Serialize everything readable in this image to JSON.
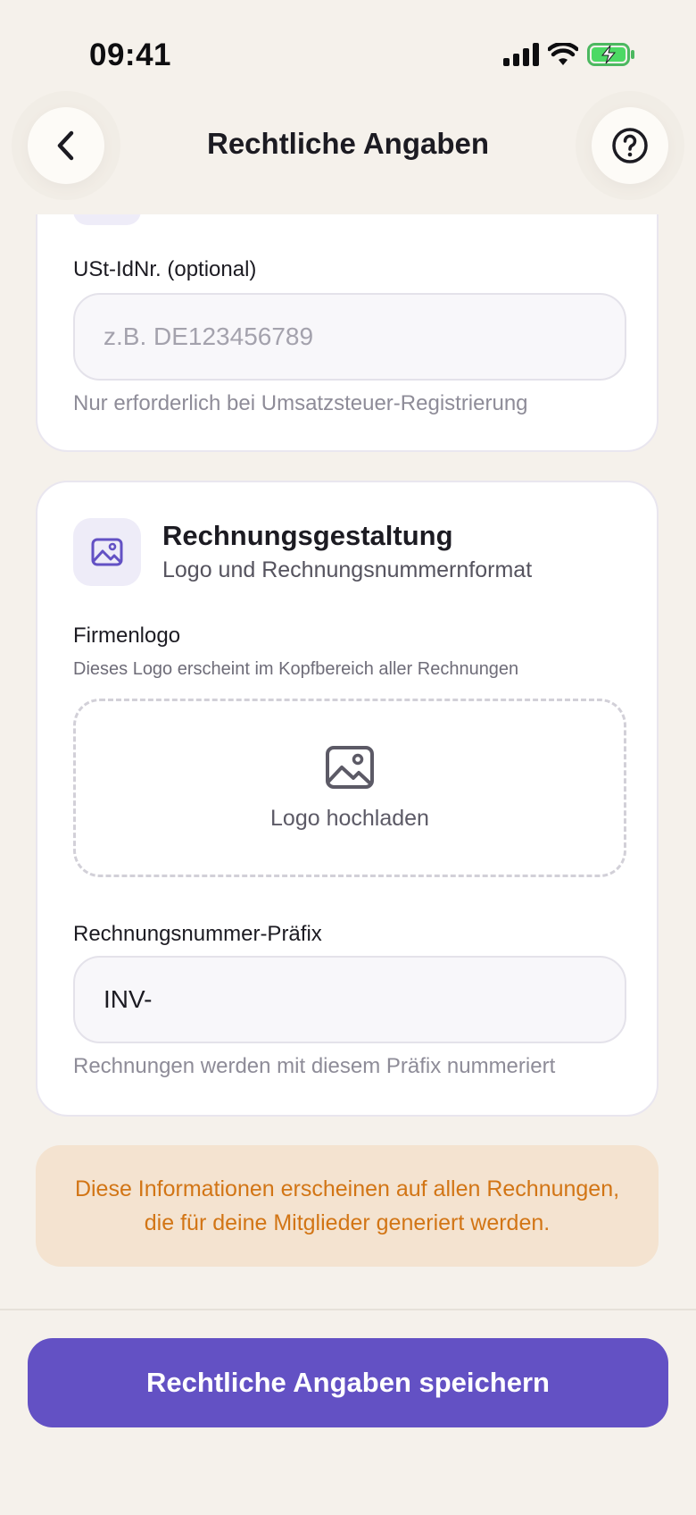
{
  "status_bar": {
    "time": "09:41"
  },
  "header": {
    "title": "Rechtliche Angaben",
    "back_icon": "chevron-left-icon",
    "help_icon": "question-circle-icon"
  },
  "tax_section": {
    "vat_label": "USt-IdNr. (optional)",
    "vat_placeholder": "z.B. DE123456789",
    "vat_value": "",
    "vat_hint": "Nur erforderlich bei Umsatzsteuer-Registrierung"
  },
  "invoice_design": {
    "icon": "image-icon",
    "title": "Rechnungsgestaltung",
    "subtitle": "Logo und Rechnungsnummernformat",
    "logo_label": "Firmenlogo",
    "logo_hint": "Dieses Logo erscheint im Kopfbereich aller Rechnungen",
    "upload_label": "Logo hochladen",
    "prefix_label": "Rechnungsnummer-Präfix",
    "prefix_value": "INV-",
    "prefix_hint": "Rechnungen werden mit diesem Präfix nummeriert"
  },
  "info_note": {
    "text": "Diese Informationen erscheinen auf allen Rechnungen, die für deine Mitglieder generiert werden."
  },
  "footer": {
    "save_label": "Rechtliche Angaben speichern"
  },
  "colors": {
    "background": "#f5f1eb",
    "accent": "#6351c4",
    "info_background": "#f4e3d0",
    "info_text": "#d27515"
  }
}
